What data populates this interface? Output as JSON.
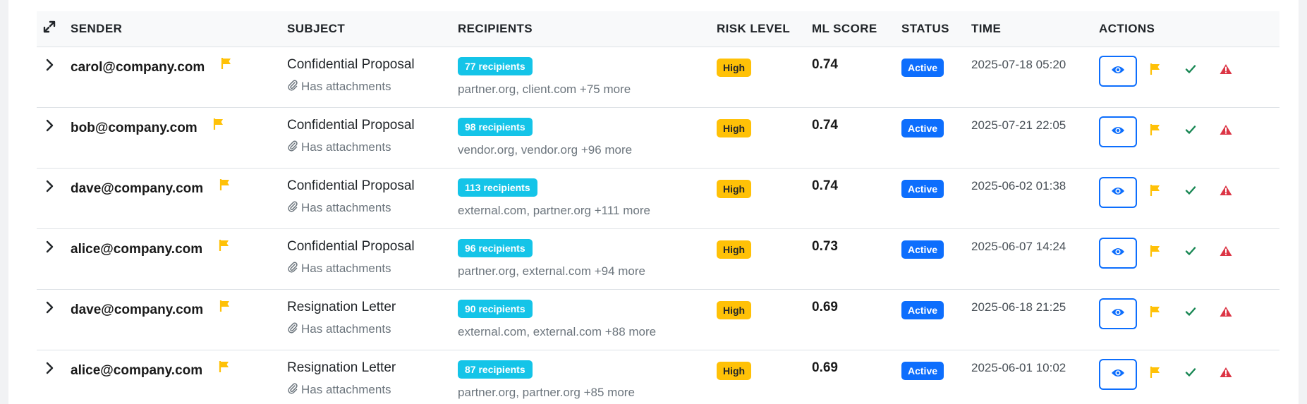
{
  "headers": {
    "sender": "SENDER",
    "subject": "SUBJECT",
    "recipients": "RECIPIENTS",
    "risk_level": "RISK LEVEL",
    "ml_score": "ML SCORE",
    "status": "STATUS",
    "time": "TIME",
    "actions": "ACTIONS"
  },
  "icons": {
    "expand_all": "expand-arrows-icon",
    "row_toggle": "chevron-right-icon",
    "flag": "flag-icon",
    "attachment": "paperclip-icon",
    "view": "eye-icon",
    "approve": "check-icon",
    "escalate": "warning-triangle-icon"
  },
  "colors": {
    "flag": "#ffc107",
    "recipient_badge": "#14c4e8",
    "risk_high": "#ffc107",
    "status_active": "#0d6efd",
    "check": "#198754",
    "alert": "#dc3545"
  },
  "rows": [
    {
      "sender": "carol@company.com",
      "subject": "Confidential Proposal",
      "attachment_text": "Has attachments",
      "recipients_badge": "77 recipients",
      "recipients_list": "partner.org, client.com +75 more",
      "risk": "High",
      "ml_score": "0.74",
      "status": "Active",
      "time": "2025-07-18 05:20"
    },
    {
      "sender": "bob@company.com",
      "subject": "Confidential Proposal",
      "attachment_text": "Has attachments",
      "recipients_badge": "98 recipients",
      "recipients_list": "vendor.org, vendor.org +96 more",
      "risk": "High",
      "ml_score": "0.74",
      "status": "Active",
      "time": "2025-07-21 22:05"
    },
    {
      "sender": "dave@company.com",
      "subject": "Confidential Proposal",
      "attachment_text": "Has attachments",
      "recipients_badge": "113 recipients",
      "recipients_list": "external.com, partner.org +111 more",
      "risk": "High",
      "ml_score": "0.74",
      "status": "Active",
      "time": "2025-06-02 01:38"
    },
    {
      "sender": "alice@company.com",
      "subject": "Confidential Proposal",
      "attachment_text": "Has attachments",
      "recipients_badge": "96 recipients",
      "recipients_list": "partner.org, external.com +94 more",
      "risk": "High",
      "ml_score": "0.73",
      "status": "Active",
      "time": "2025-06-07 14:24"
    },
    {
      "sender": "dave@company.com",
      "subject": "Resignation Letter",
      "attachment_text": "Has attachments",
      "recipients_badge": "90 recipients",
      "recipients_list": "external.com, external.com +88 more",
      "risk": "High",
      "ml_score": "0.69",
      "status": "Active",
      "time": "2025-06-18 21:25"
    },
    {
      "sender": "alice@company.com",
      "subject": "Resignation Letter",
      "attachment_text": "Has attachments",
      "recipients_badge": "87 recipients",
      "recipients_list": "partner.org, partner.org +85 more",
      "risk": "High",
      "ml_score": "0.69",
      "status": "Active",
      "time": "2025-06-01 10:02"
    }
  ]
}
